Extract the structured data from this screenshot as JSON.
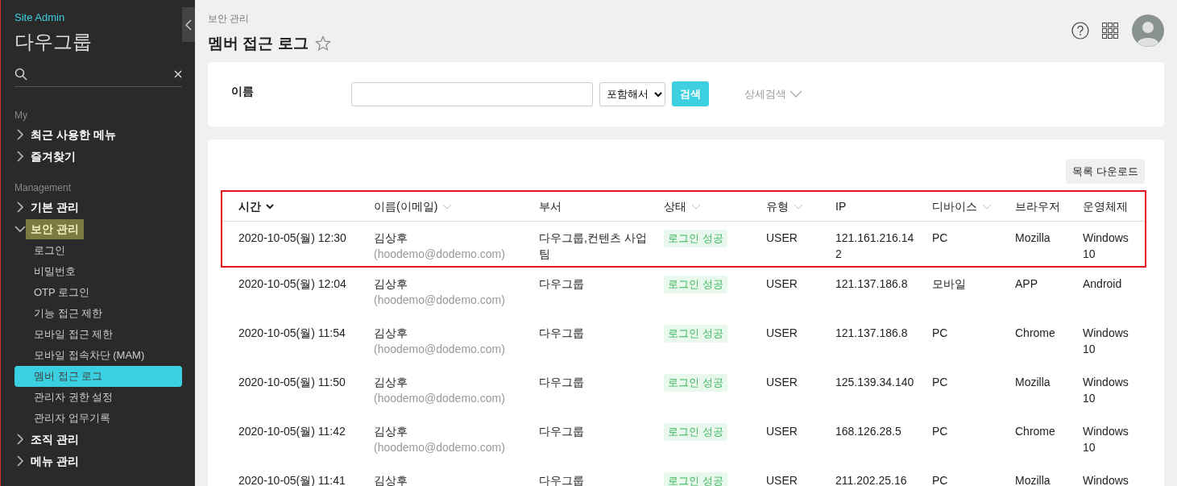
{
  "sidebar": {
    "brand": "Site Admin",
    "title": "다우그룹",
    "sections": [
      {
        "label": "My",
        "items": [
          {
            "label": "최근 사용한 메뉴",
            "expanded": false,
            "highlighted": false
          },
          {
            "label": "즐겨찾기",
            "expanded": false,
            "highlighted": false
          }
        ]
      },
      {
        "label": "Management",
        "items": [
          {
            "label": "기본 관리",
            "expanded": false,
            "highlighted": false
          },
          {
            "label": "보안 관리",
            "expanded": true,
            "highlighted": true,
            "children": [
              {
                "label": "로그인",
                "selected": false
              },
              {
                "label": "비밀번호",
                "selected": false
              },
              {
                "label": "OTP 로그인",
                "selected": false
              },
              {
                "label": "기능 접근 제한",
                "selected": false
              },
              {
                "label": "모바일 접근 제한",
                "selected": false
              },
              {
                "label": "모바일 접속차단 (MAM)",
                "selected": false
              },
              {
                "label": "멤버 접근 로그",
                "selected": true
              },
              {
                "label": "관리자 권한 설정",
                "selected": false
              },
              {
                "label": "관리자 업무기록",
                "selected": false
              }
            ]
          },
          {
            "label": "조직 관리",
            "expanded": false,
            "highlighted": false
          },
          {
            "label": "메뉴 관리",
            "expanded": false,
            "highlighted": false
          }
        ]
      }
    ]
  },
  "breadcrumb": "보안 관리",
  "page_title": "멤버 접근 로그",
  "favorite": false,
  "search_form": {
    "label": "이름",
    "match": "포함해서",
    "button": "검색",
    "advanced": "상세검색"
  },
  "download_button": "목록 다운로드",
  "table": {
    "outlined_rows": true,
    "columns": [
      {
        "label": "시간",
        "sortable": true,
        "sorted": true
      },
      {
        "label": "이름(이메일)",
        "sortable": true,
        "sorted": false
      },
      {
        "label": "부서",
        "sortable": false
      },
      {
        "label": "상태",
        "sortable": true,
        "sorted": false
      },
      {
        "label": "유형",
        "sortable": true,
        "sorted": false
      },
      {
        "label": "IP",
        "sortable": false
      },
      {
        "label": "디바이스",
        "sortable": true,
        "sorted": false
      },
      {
        "label": "브라우저",
        "sortable": false
      },
      {
        "label": "운영체제",
        "sortable": false
      }
    ],
    "rows": [
      {
        "time": "2020-10-05(월) 12:30",
        "name": "김상후",
        "email": "(hoodemo@dodemo.com)",
        "dept": "다우그룹,컨텐츠 사업팀",
        "status": "로그인 성공",
        "type": "USER",
        "ip": "121.161.216.142",
        "device": "PC",
        "browser": "Mozilla",
        "os": "Windows 10"
      },
      {
        "time": "2020-10-05(월) 12:04",
        "name": "김상후",
        "email": "(hoodemo@dodemo.com)",
        "dept": "다우그룹",
        "status": "로그인 성공",
        "type": "USER",
        "ip": "121.137.186.8",
        "device": "모바일",
        "browser": "APP",
        "os": "Android"
      },
      {
        "time": "2020-10-05(월) 11:54",
        "name": "김상후",
        "email": "(hoodemo@dodemo.com)",
        "dept": "다우그룹",
        "status": "로그인 성공",
        "type": "USER",
        "ip": "121.137.186.8",
        "device": "PC",
        "browser": "Chrome",
        "os": "Windows 10"
      },
      {
        "time": "2020-10-05(월) 11:50",
        "name": "김상후",
        "email": "(hoodemo@dodemo.com)",
        "dept": "다우그룹",
        "status": "로그인 성공",
        "type": "USER",
        "ip": "125.139.34.140",
        "device": "PC",
        "browser": "Mozilla",
        "os": "Windows 10"
      },
      {
        "time": "2020-10-05(월) 11:42",
        "name": "김상후",
        "email": "(hoodemo@dodemo.com)",
        "dept": "다우그룹",
        "status": "로그인 성공",
        "type": "USER",
        "ip": "168.126.28.5",
        "device": "PC",
        "browser": "Chrome",
        "os": "Windows 10"
      },
      {
        "time": "2020-10-05(월) 11:41",
        "name": "김상후",
        "dept": "다우그룹",
        "status": "로그인 성공",
        "type": "USER",
        "ip": "211.202.25.16",
        "device": "PC",
        "browser": "Mozilla",
        "os": "Windows"
      }
    ]
  }
}
